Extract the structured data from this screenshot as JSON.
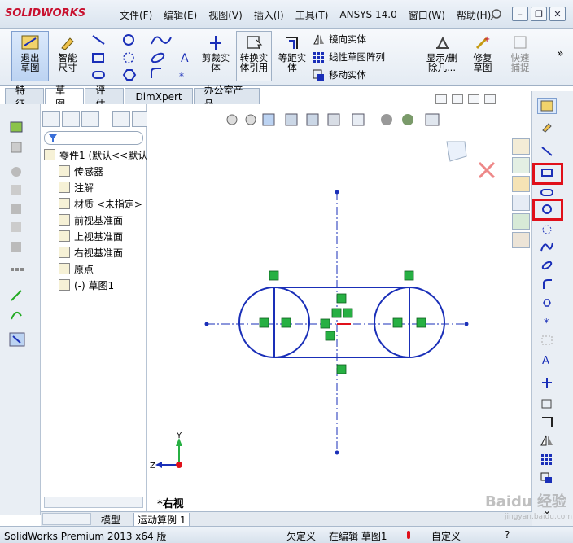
{
  "app": {
    "logo": "SOLIDWORKS"
  },
  "menu": {
    "items": [
      "文件(F)",
      "编辑(E)",
      "视图(V)",
      "插入(I)",
      "工具(T)",
      "ANSYS 14.0",
      "窗口(W)",
      "帮助(H)"
    ]
  },
  "window_buttons": {
    "minimize": "–",
    "restore": "❐",
    "close": "✕"
  },
  "ribbon": {
    "exit_sketch": "退出草图",
    "smart_dimension": "智能尺寸",
    "trim": "剪裁实体",
    "convert": "转换实体引用",
    "offset": "等距实体",
    "mirror": "镜向实体",
    "linear_pattern": "线性草图阵列",
    "move": "移动实体",
    "show_delete": "显示/删除几...",
    "repair": "修复草图",
    "quick_snap": "快速捕捉",
    "more": "»"
  },
  "tabs": [
    "特征",
    "草图",
    "评估",
    "DimXpert",
    "办公室产品"
  ],
  "tree": {
    "root": "零件1 (默认<<默认",
    "items": [
      {
        "label": "传感器",
        "icon": "sensor-icon"
      },
      {
        "label": "注解",
        "icon": "annotation-icon"
      },
      {
        "label": "材质 <未指定>",
        "icon": "material-icon"
      },
      {
        "label": "前视基准面",
        "icon": "plane-icon"
      },
      {
        "label": "上视基准面",
        "icon": "plane-icon"
      },
      {
        "label": "右视基准面",
        "icon": "plane-icon"
      },
      {
        "label": "原点",
        "icon": "origin-icon"
      },
      {
        "label": "(-) 草图1",
        "icon": "sketch-icon"
      }
    ]
  },
  "canvas": {
    "view_label": "*右视",
    "axis_z": "Z",
    "axis_y": "Y"
  },
  "bottom_tabs": [
    "模型",
    "运动算例 1"
  ],
  "status": {
    "app": "SolidWorks Premium 2013 x64 版",
    "definition": "欠定义",
    "editing": "在编辑 草图1",
    "units": "自定义",
    "help": "?"
  },
  "colors": {
    "sketch": "#1a2fb8",
    "relation": "#27b043",
    "highlight": "#e0101a"
  },
  "watermark": {
    "brand": "Baidu 经验",
    "url": "jingyan.baidu.com"
  }
}
